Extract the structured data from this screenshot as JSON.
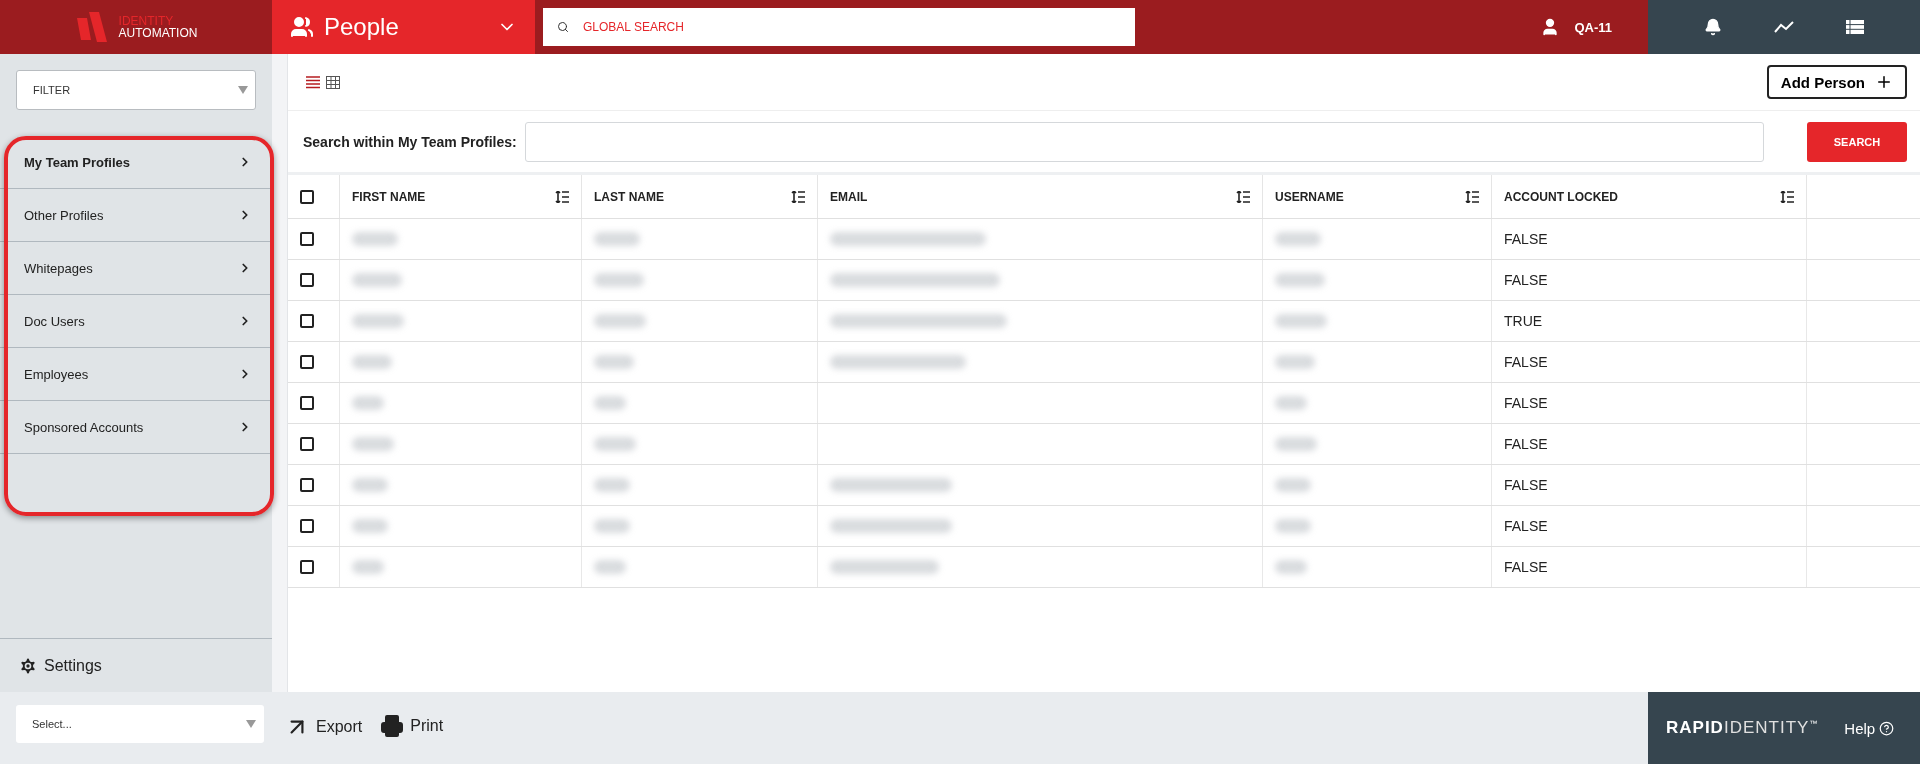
{
  "header": {
    "brand": {
      "line1": "IDENTITY",
      "line2": "AUTOMATION"
    },
    "module": "People",
    "search": {
      "placeholder": "GLOBAL SEARCH"
    },
    "user": "QA-11"
  },
  "sidebar": {
    "filter": {
      "placeholder": "FILTER"
    },
    "highlighted": true,
    "items": [
      {
        "label": "My Team Profiles",
        "selected": true
      },
      {
        "label": "Other Profiles",
        "selected": false
      },
      {
        "label": "Whitepages",
        "selected": false
      },
      {
        "label": "Doc Users",
        "selected": false
      },
      {
        "label": "Employees",
        "selected": false
      },
      {
        "label": "Sponsored Accounts",
        "selected": false
      }
    ],
    "settings": "Settings"
  },
  "toolbar": {
    "views": [
      {
        "kind": "list",
        "selected": true
      },
      {
        "kind": "grid",
        "selected": false
      }
    ],
    "add_button": "Add Person"
  },
  "search": {
    "label": "Search within My Team Profiles:",
    "button": "SEARCH"
  },
  "table": {
    "select_all_checked": false,
    "columns": [
      "FIRST NAME",
      "LAST NAME",
      "EMAIL",
      "USERNAME",
      "ACCOUNT LOCKED"
    ],
    "rows": [
      {
        "checked": false,
        "cells": [
          {
            "kind": "blurred"
          },
          {
            "kind": "blurred"
          },
          {
            "kind": "blurred"
          },
          {
            "kind": "blurred"
          },
          {
            "kind": "text",
            "text": "FALSE"
          }
        ]
      },
      {
        "checked": false,
        "cells": [
          {
            "kind": "blurred"
          },
          {
            "kind": "blurred"
          },
          {
            "kind": "blurred"
          },
          {
            "kind": "blurred"
          },
          {
            "kind": "text",
            "text": "FALSE"
          }
        ]
      },
      {
        "checked": false,
        "cells": [
          {
            "kind": "blurred"
          },
          {
            "kind": "blurred"
          },
          {
            "kind": "blurred"
          },
          {
            "kind": "blurred"
          },
          {
            "kind": "text",
            "text": "TRUE"
          }
        ]
      },
      {
        "checked": false,
        "cells": [
          {
            "kind": "blurred"
          },
          {
            "kind": "blurred"
          },
          {
            "kind": "blurred"
          },
          {
            "kind": "blurred"
          },
          {
            "kind": "text",
            "text": "FALSE"
          }
        ]
      },
      {
        "checked": false,
        "cells": [
          {
            "kind": "blurred"
          },
          {
            "kind": "blurred"
          },
          {
            "kind": "empty"
          },
          {
            "kind": "blurred"
          },
          {
            "kind": "text",
            "text": "FALSE"
          }
        ]
      },
      {
        "checked": false,
        "cells": [
          {
            "kind": "blurred"
          },
          {
            "kind": "blurred"
          },
          {
            "kind": "empty"
          },
          {
            "kind": "blurred"
          },
          {
            "kind": "text",
            "text": "FALSE"
          }
        ]
      },
      {
        "checked": false,
        "cells": [
          {
            "kind": "blurred"
          },
          {
            "kind": "blurred"
          },
          {
            "kind": "blurred"
          },
          {
            "kind": "blurred"
          },
          {
            "kind": "text",
            "text": "FALSE"
          }
        ]
      },
      {
        "checked": false,
        "cells": [
          {
            "kind": "blurred"
          },
          {
            "kind": "blurred"
          },
          {
            "kind": "blurred"
          },
          {
            "kind": "blurred"
          },
          {
            "kind": "text",
            "text": "FALSE"
          }
        ]
      },
      {
        "checked": false,
        "cells": [
          {
            "kind": "blurred"
          },
          {
            "kind": "blurred"
          },
          {
            "kind": "blurred"
          },
          {
            "kind": "blurred"
          },
          {
            "kind": "text",
            "text": "FALSE"
          }
        ]
      }
    ]
  },
  "footer": {
    "select": {
      "placeholder": "Select..."
    },
    "export": "Export",
    "print": "Print",
    "brand": {
      "bold": "RAPID",
      "light": "IDENTITY",
      "mark": "™"
    },
    "help": "Help"
  }
}
